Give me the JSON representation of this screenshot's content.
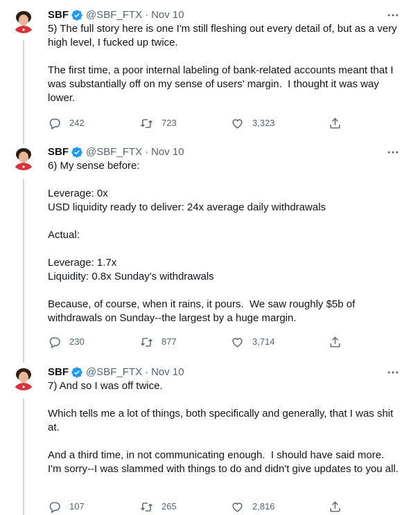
{
  "colors": {
    "text": "#0f1419",
    "muted": "#536471",
    "verified": "#1d9bf0",
    "line": "#cfd9de"
  },
  "tweets": [
    {
      "name": "SBF",
      "handle": "@SBF_FTX",
      "dot": "·",
      "date": "Nov 10",
      "text": "5) The full story here is one I'm still fleshing out every detail of, but as a very high level, I fucked up twice.\n\nThe first time, a poor internal labeling of bank-related accounts meant that I was substantially off on my sense of users' margin.  I thought it was way lower.",
      "replies": "242",
      "retweets": "723",
      "likes": "3,323",
      "icons": {
        "reply": "reply-icon",
        "retweet": "retweet-icon",
        "like": "heart-icon",
        "share": "share-icon",
        "more": "more-icon",
        "verified": "verified-badge-icon"
      }
    },
    {
      "name": "SBF",
      "handle": "@SBF_FTX",
      "dot": "·",
      "date": "Nov 10",
      "text": "6) My sense before:\n\nLeverage: 0x\nUSD liquidity ready to deliver: 24x average daily withdrawals\n\nActual:\n\nLeverage: 1.7x\nLiquidity: 0.8x Sunday's withdrawals\n\nBecause, of course, when it rains, it pours.  We saw roughly $5b of withdrawals on Sunday--the largest by a huge margin.",
      "replies": "230",
      "retweets": "877",
      "likes": "3,714"
    },
    {
      "name": "SBF",
      "handle": "@SBF_FTX",
      "dot": "·",
      "date": "Nov 10",
      "text": "7) And so I was off twice.\n\nWhich tells me a lot of things, both specifically and generally, that I was shit at.\n\nAnd a third time, in not communicating enough.  I should have said more.  I'm sorry--I was slammed with things to do and didn't give updates to you all.",
      "replies": "107",
      "retweets": "265",
      "likes": "2,816"
    }
  ]
}
